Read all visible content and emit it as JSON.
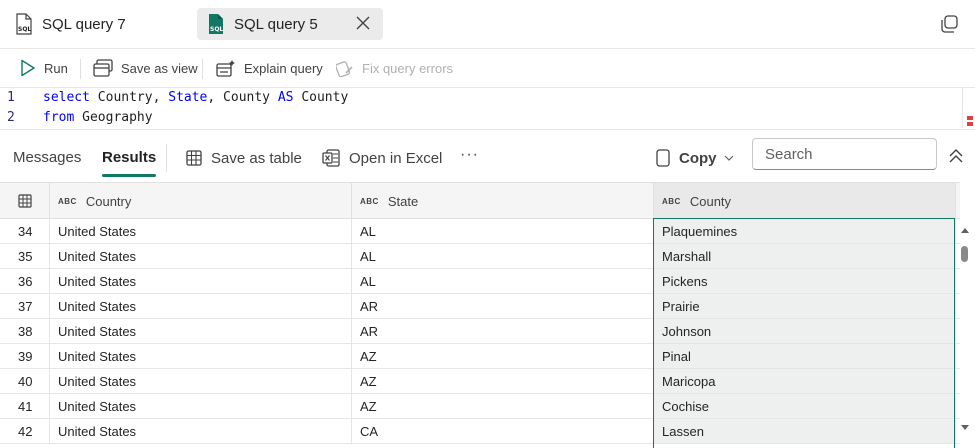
{
  "tabs": [
    {
      "label": "SQL query 7",
      "active": false
    },
    {
      "label": "SQL query 5",
      "active": true
    }
  ],
  "toolbar": {
    "run": "Run",
    "save_as_view": "Save as view",
    "explain_query": "Explain query",
    "fix_query_errors": "Fix query errors"
  },
  "editor": {
    "lines": [
      {
        "num": "1",
        "kw1": "select",
        "t1": " Country, ",
        "kw2": "State",
        "t2": ", County ",
        "kw3": "AS",
        "t3": " County"
      },
      {
        "num": "2",
        "kw1": "from",
        "t1": " Geography"
      }
    ]
  },
  "results": {
    "tab_messages": "Messages",
    "tab_results": "Results",
    "save_as_table": "Save as table",
    "open_in_excel": "Open in Excel",
    "more": "···",
    "copy": "Copy",
    "search_placeholder": "Search",
    "type_label": "ABC",
    "columns": [
      "Country",
      "State",
      "County"
    ],
    "rows": [
      [
        "34",
        "United States",
        "AL",
        "Plaquemines"
      ],
      [
        "35",
        "United States",
        "AL",
        "Marshall"
      ],
      [
        "36",
        "United States",
        "AL",
        "Pickens"
      ],
      [
        "37",
        "United States",
        "AR",
        "Prairie"
      ],
      [
        "38",
        "United States",
        "AR",
        "Johnson"
      ],
      [
        "39",
        "United States",
        "AZ",
        "Pinal"
      ],
      [
        "40",
        "United States",
        "AZ",
        "Maricopa"
      ],
      [
        "41",
        "United States",
        "AZ",
        "Cochise"
      ],
      [
        "42",
        "United States",
        "CA",
        "Lassen"
      ]
    ]
  },
  "colors": {
    "accent": "#117865",
    "keyword": "#0000ff"
  }
}
